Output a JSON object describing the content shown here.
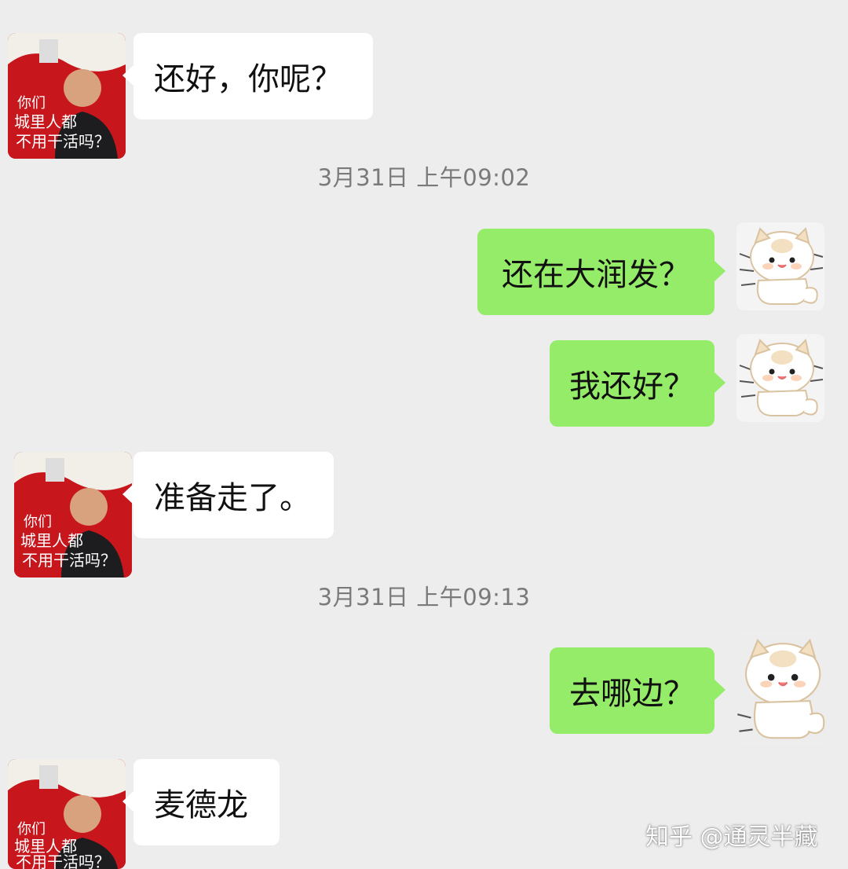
{
  "messages": [
    {
      "side": "left",
      "text": "还好，你呢？"
    },
    {
      "type": "timestamp",
      "text": "3月31日 上午09:02"
    },
    {
      "side": "right",
      "text": "还在大润发？"
    },
    {
      "side": "right",
      "text": "我还好？"
    },
    {
      "side": "left",
      "text": "准备走了。"
    },
    {
      "type": "timestamp",
      "text": "3月31日 上午09:13"
    },
    {
      "side": "right",
      "text": "去哪边？"
    },
    {
      "side": "left",
      "text": "麦德龙"
    }
  ],
  "left_avatar": {
    "icon": "meme-avatar-icon",
    "caption_lines": [
      "你们",
      "城里人都",
      "不用干活吗？"
    ]
  },
  "right_avatar": {
    "icon": "cat-sticker-avatar-icon"
  },
  "watermark": {
    "text": "知乎 @通灵半藏"
  },
  "colors": {
    "background": "#ededed",
    "incoming_bubble": "#ffffff",
    "outgoing_bubble": "#95ec69",
    "timestamp": "#7a7a7a"
  }
}
